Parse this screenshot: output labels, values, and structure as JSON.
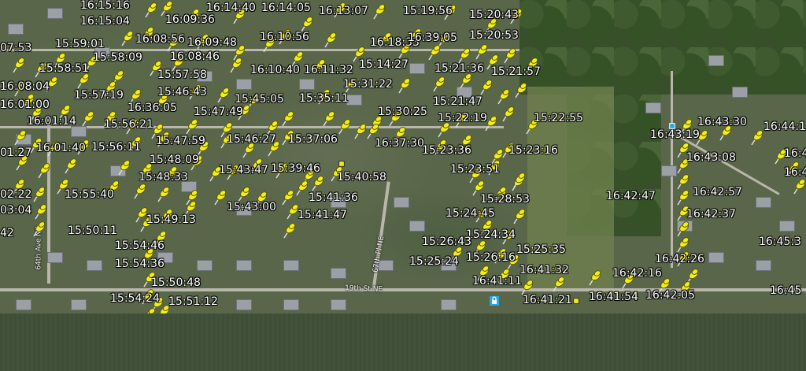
{
  "map": {
    "streets": [
      {
        "name": "64th Ave NE"
      },
      {
        "name": "67th Pl NE"
      },
      {
        "name": "19th St NE"
      }
    ],
    "colors": {
      "pin_fill": "#f2ee1a",
      "pin_stroke": "#5d5a00",
      "label_text": "#ffffff",
      "poi_blue": "#2aa7e0"
    },
    "labels": [
      "16:15:16",
      "16:14:40",
      "16:14:05",
      "16:13:07",
      "15:19:56",
      "15:20:43",
      "16:09:36",
      "16:15:04",
      "16:08:56",
      "16:09:48",
      "16:10:56",
      "16:18:33",
      "16:39:05",
      "15:20:53",
      "07:53",
      "15:59:01",
      "15:58:09",
      "16:08:46",
      "15:58:51",
      "16:10:40",
      "16:11:32",
      "15:14:27",
      "15:21:36",
      "15:21:57",
      "15:57:58",
      "16:08:04",
      "15:31:22",
      "15:57:19",
      "15:46:43",
      "15:45:05",
      "15:35:11",
      "15:21:47",
      "16:01:00",
      "16:36:05",
      "15:47:49",
      "15:30:25",
      "15:22:19",
      "15:22:55",
      "16:01:14",
      "15:56:21",
      "16:43:30",
      "16:44:1",
      "15:46:27",
      "15:37:06",
      "16:37:30",
      "16:43:19",
      "15:47:59",
      "01:27",
      "16:01:40",
      "15:56:11",
      "15:23:36",
      "15:23:16",
      "16:4",
      "16:43:08",
      "15:48:09",
      "15:39:46",
      "15:40:58",
      "15:43:47",
      "15:23:51",
      "16:44",
      "15:48:33",
      "02:22",
      "15:55:40",
      "15:41:36",
      "15:28:53",
      "16:42:47",
      "16:42:57",
      "03:04",
      "15:43:00",
      "15:41:47",
      "15:24:45",
      "16:42:37",
      "15:49:13",
      "15:50:11",
      "15:24:34",
      "42",
      "16:45:3",
      "15:54:46",
      "15:26:43",
      "15:25:35",
      "15:54:36",
      "15:25:24",
      "15:26:16",
      "16:42:26",
      "16:41:32",
      "16:42:16",
      "15:50:48",
      "16:41:11",
      "15:54:24",
      "15:51:12",
      "16:41:21",
      "16:41:54",
      "16:42:05",
      "16:45"
    ]
  }
}
